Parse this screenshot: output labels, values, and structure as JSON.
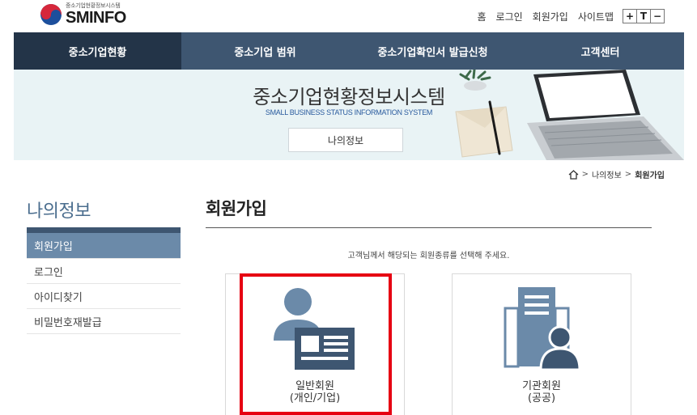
{
  "header": {
    "logo_sub": "중소기업현황정보시스템",
    "logo_main": "SMINFO",
    "util_links": [
      "홈",
      "로그인",
      "회원가입",
      "사이트맵"
    ],
    "font_controls": [
      "+",
      "T",
      "−"
    ]
  },
  "gnb": {
    "items": [
      "중소기업현황",
      "중소기업 범위",
      "중소기업확인서 발급신청",
      "고객센터"
    ],
    "active_index": 0
  },
  "visual": {
    "title": "중소기업현황정보시스템",
    "subtitle": "SMALL BUSINESS STATUS INFORMATION SYSTEM",
    "button": "나의정보"
  },
  "breadcrumb": {
    "items": [
      "나의정보",
      "회원가입"
    ]
  },
  "lnb": {
    "title": "나의정보",
    "items": [
      "회원가입",
      "로그인",
      "아이디찾기",
      "비밀번호재발급"
    ],
    "active_index": 0
  },
  "content": {
    "title": "회원가입",
    "guide": "고객님께서 해당되는 회원종류를 선택해 주세요.",
    "cards": [
      {
        "line1": "일반회원",
        "line2": "(개인/기업)"
      },
      {
        "line1": "기관회원",
        "line2": "(공공)"
      }
    ]
  },
  "colors": {
    "gnb_bg": "#3e5671",
    "gnb_active": "#233448",
    "lnb_active": "#6b8aa9",
    "highlight": "#e60012",
    "banner_bg": "#e9f3f5"
  }
}
